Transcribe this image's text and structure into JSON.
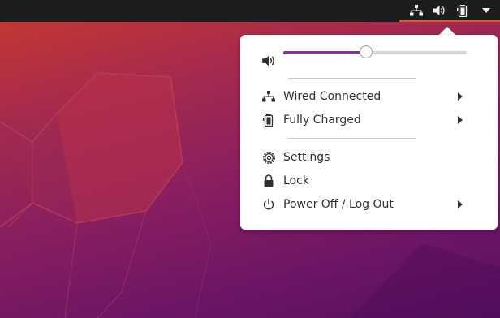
{
  "topbar": {
    "tray_icons": [
      "network-wired-icon",
      "volume-icon",
      "battery-icon",
      "menu-dropdown-icon"
    ]
  },
  "menu": {
    "volume": {
      "icon": "volume-icon",
      "level": 0.45
    },
    "items": [
      {
        "label": "Wired Connected",
        "icon": "network-wired-icon",
        "submenu": true
      },
      {
        "label": "Fully Charged",
        "icon": "battery-icon",
        "submenu": true
      },
      {
        "label": "Settings",
        "icon": "gear-icon",
        "submenu": false
      },
      {
        "label": "Lock",
        "icon": "lock-icon",
        "submenu": false
      },
      {
        "label": "Power Off / Log Out",
        "icon": "power-icon",
        "submenu": true
      }
    ]
  },
  "colors": {
    "topbar_bg": "#1d1d1d",
    "accent": "#e95420",
    "slider_fill": "#7a3d8c",
    "menu_bg": "#ffffff",
    "menu_text": "#303030"
  }
}
